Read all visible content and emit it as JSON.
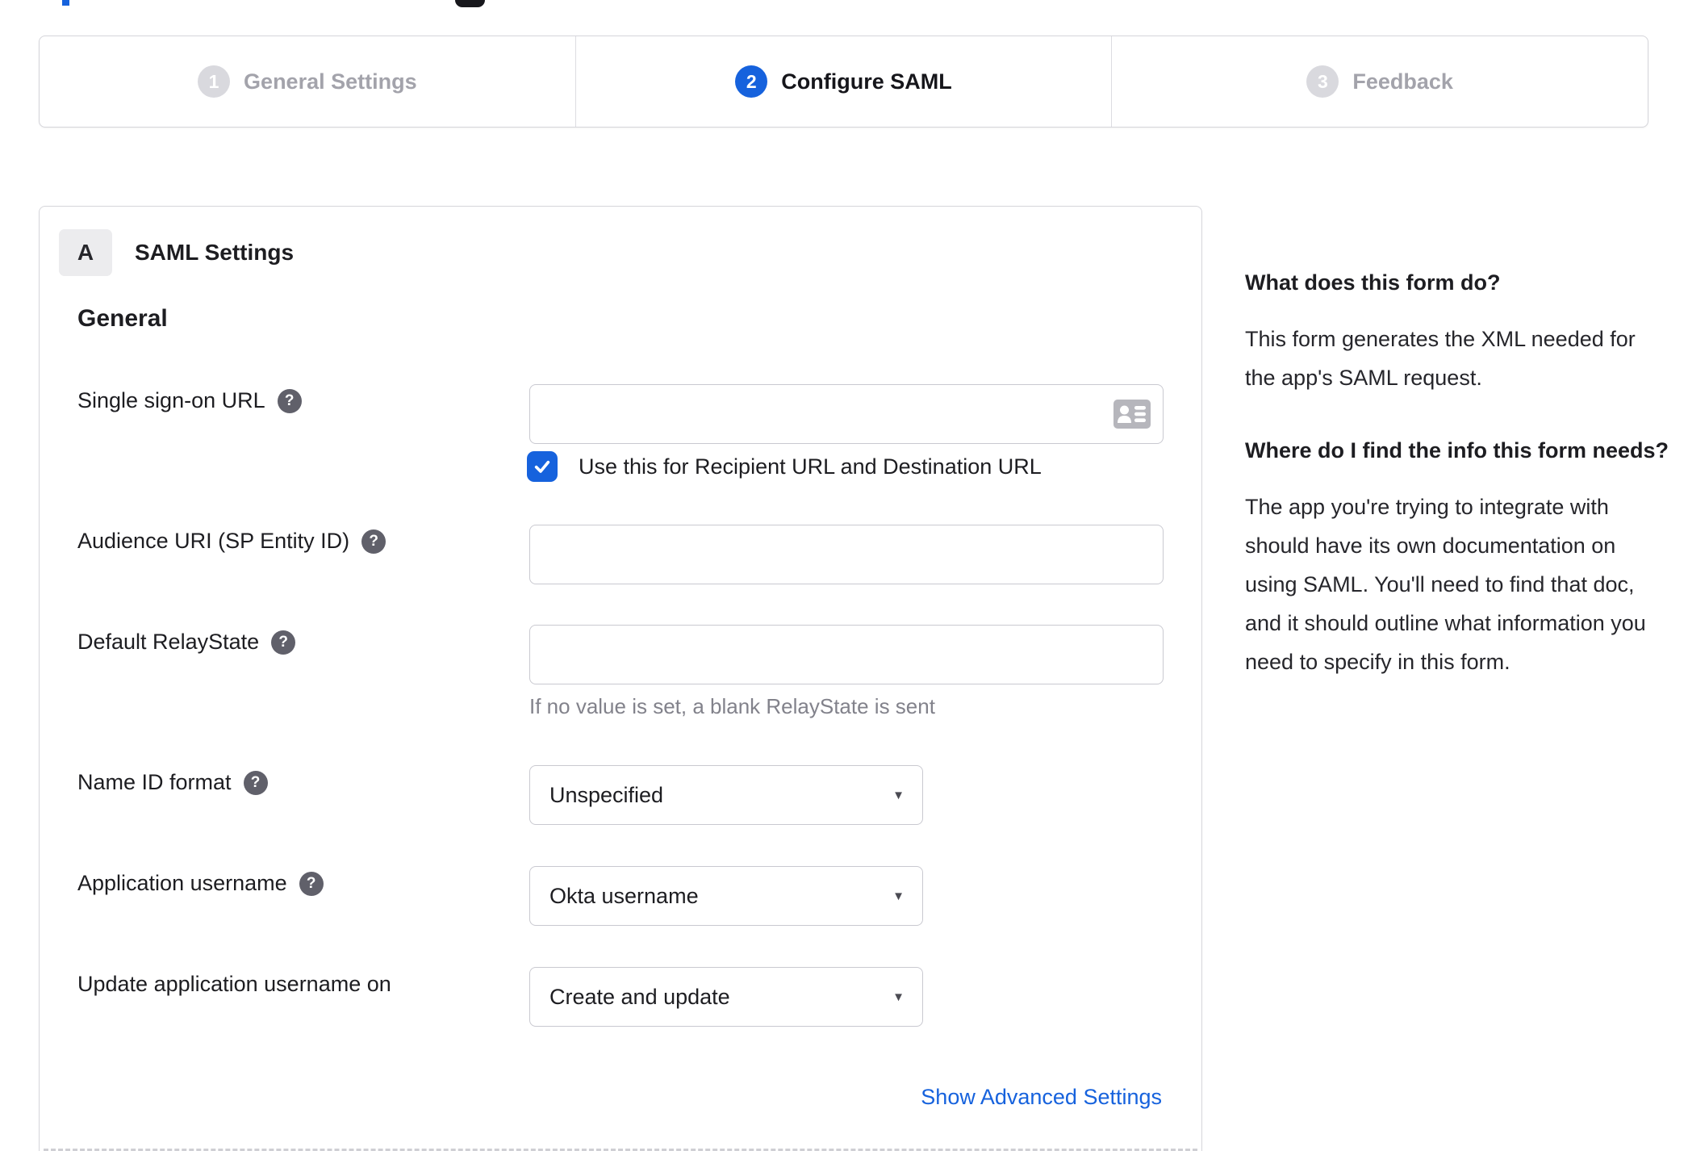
{
  "icons": {
    "help": "?",
    "caret": "▼"
  },
  "stepper": {
    "steps": [
      {
        "number": "1",
        "label": "General Settings",
        "active": false
      },
      {
        "number": "2",
        "label": "Configure SAML",
        "active": true
      },
      {
        "number": "3",
        "label": "Feedback",
        "active": false
      }
    ]
  },
  "card": {
    "badge": "A",
    "title": "SAML Settings",
    "section": "General",
    "fields": {
      "sso_url": {
        "label": "Single sign-on URL",
        "value": "",
        "trailing_icon": "contact-card-icon"
      },
      "sso_checkbox": {
        "checked": true,
        "label": "Use this for Recipient URL and Destination URL"
      },
      "audience_uri": {
        "label": "Audience URI (SP Entity ID)",
        "value": ""
      },
      "relay_state": {
        "label": "Default RelayState",
        "value": "",
        "hint": "If no value is set, a blank RelayState is sent"
      },
      "name_id_format": {
        "label": "Name ID format",
        "value": "Unspecified"
      },
      "app_username": {
        "label": "Application username",
        "value": "Okta username"
      },
      "update_app_username": {
        "label": "Update application username on",
        "value": "Create and update"
      }
    },
    "advanced_link": "Show Advanced Settings"
  },
  "sidebar": {
    "what": {
      "heading": "What does this form do?",
      "body": "This form generates the XML needed for the app's SAML request."
    },
    "where": {
      "heading": "Where do I find the info this form needs?",
      "body": "The app you're trying to integrate with should have its own documentation on using SAML. You'll need to find that doc, and it should outline what information you need to specify in this form."
    }
  },
  "colors": {
    "accent_blue": "#1662dd",
    "inactive_gray": "#d9d9de",
    "text_dark": "#1d1d21",
    "muted_text": "#82828b",
    "border": "#d5d5da"
  }
}
